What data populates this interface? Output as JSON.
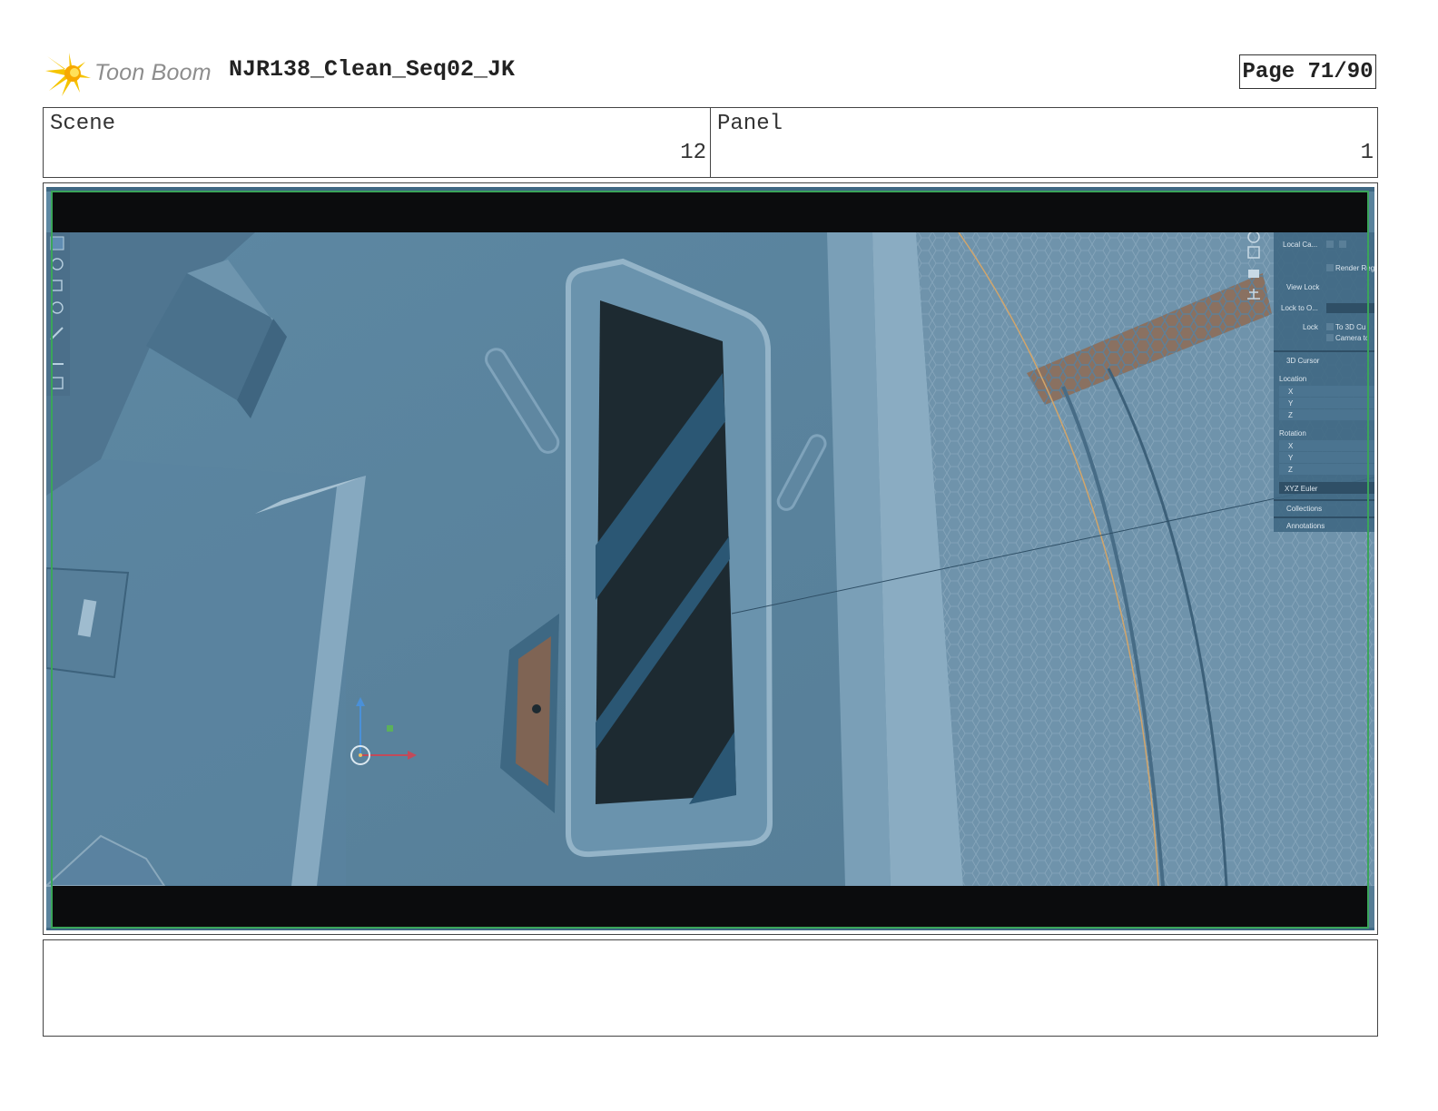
{
  "header": {
    "logo_text": "Toon Boom",
    "doc_title": "NJR138_Clean_Seq02_JK",
    "page_label": "Page 71/90"
  },
  "info": {
    "scene_label": "Scene",
    "scene_value": "12",
    "panel_label": "Panel",
    "panel_value": "1"
  },
  "viewport_panel": {
    "local_camera": "Local Ca...",
    "render_region": "Render Reg",
    "view_lock": "View Lock",
    "lock_to": "Lock to O...",
    "lock": "Lock",
    "to_3d_cursor": "To 3D Cu",
    "camera_to": "Camera to",
    "cursor_3d": "3D Cursor",
    "location": "Location",
    "x": "X",
    "y": "Y",
    "z": "Z",
    "rotation": "Rotation",
    "rx": "X",
    "ry": "Y",
    "rz": "Z",
    "euler": "XYZ Euler",
    "collections": "Collections",
    "annotations": "Annotations"
  },
  "notes": ""
}
